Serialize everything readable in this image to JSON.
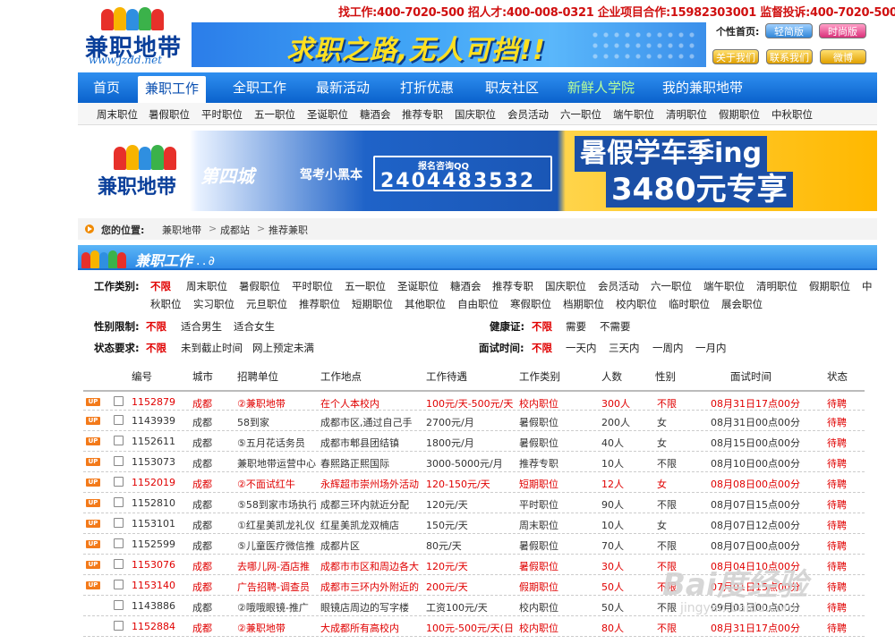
{
  "logo": {
    "text": "兼职地带",
    "url": "www.jzdd.net",
    "figure_colors": [
      "#e7302a",
      "#f8b400",
      "#2f8fe0",
      "#3bb24a",
      "#e7302a"
    ]
  },
  "hotline": "找工作:400-7020-500  招人才:400-008-0321  企业项目合作:15982303001  监督投诉:400-7020-500",
  "banner": {
    "slogan": "求职之路,无人可挡!!"
  },
  "header_buttons": {
    "personal_label": "个性首页:",
    "skin1": "轻简版",
    "skin2": "时尚版",
    "about": "关于我们",
    "contact": "联系我们",
    "weibo": "微博"
  },
  "main_nav": [
    {
      "label": "首页",
      "active": false
    },
    {
      "label": "兼职工作",
      "active": true
    },
    {
      "label": "全职工作",
      "active": false
    },
    {
      "label": "最新活动",
      "active": false
    },
    {
      "label": "打折优惠",
      "active": false
    },
    {
      "label": "职友社区",
      "active": false
    },
    {
      "label": "新鲜人学院",
      "active": false
    },
    {
      "label": "我的兼职地带",
      "active": false
    }
  ],
  "sub_nav": [
    "周末职位",
    "暑假职位",
    "平时职位",
    "五一职位",
    "圣诞职位",
    "糖酒会",
    "推荐专职",
    "国庆职位",
    "会员活动",
    "六一职位",
    "端午职位",
    "清明职位",
    "假期职位",
    "中秋职位"
  ],
  "ad": {
    "logo": "兼职地带",
    "brand": "第四城",
    "brand2": "驾考小黑本",
    "qq_label": "报名咨询QQ",
    "qq": "2404483532",
    "promo1": "暑假学车季ing",
    "promo2": "3480元专享"
  },
  "breadcrumb": {
    "label": "您的位置:",
    "items": [
      "兼职地带",
      "成都站",
      "推荐兼职"
    ],
    "sep": ">"
  },
  "section_title": "兼职工作",
  "filters": {
    "job_type_label": "工作类别:",
    "job_types_row1": [
      "不限",
      "周末职位",
      "暑假职位",
      "平时职位",
      "五一职位",
      "圣诞职位",
      "糖酒会",
      "推荐专职",
      "国庆职位",
      "会员活动",
      "六一职位",
      "端午职位",
      "清明职位",
      "假期职位",
      "中"
    ],
    "job_types_row2": [
      "秋职位",
      "实习职位",
      "元旦职位",
      "推荐职位",
      "短期职位",
      "其他职位",
      "自由职位",
      "寒假职位",
      "档期职位",
      "校内职位",
      "临时职位",
      "展会职位"
    ],
    "gender_label": "性别限制:",
    "genders": [
      "不限",
      "适合男生",
      "适合女生"
    ],
    "health_label": "健康证:",
    "health": [
      "不限",
      "需要",
      "不需要"
    ],
    "status_label": "状态要求:",
    "statuses": [
      "不限",
      "未到截止时间",
      "网上预定未满"
    ],
    "interview_label": "面试时间:",
    "interview": [
      "不限",
      "一天内",
      "三天内",
      "一周内",
      "一月内"
    ]
  },
  "table": {
    "headers": [
      "编号",
      "城市",
      "招聘单位",
      "工作地点",
      "工作待遇",
      "工作类别",
      "人数",
      "性别",
      "面试时间",
      "状态"
    ],
    "rows": [
      {
        "up": "UP",
        "id": "1152879",
        "city": "成都",
        "company": "②兼职地带",
        "location": "在个人本校内",
        "pay": "100元/天-500元/天",
        "type": "校内职位",
        "count": "300人",
        "gender": "不限",
        "time": "08月31日17点00分",
        "status": "待聘",
        "red": true
      },
      {
        "up": "UP",
        "id": "1143939",
        "city": "成都",
        "company": "58到家",
        "location": "成都市区,通过自己手",
        "pay": "2700元/月",
        "type": "暑假职位",
        "count": "200人",
        "gender": "女",
        "time": "08月31日00点00分",
        "status": "待聘",
        "red": false
      },
      {
        "up": "UP",
        "id": "1152611",
        "city": "成都",
        "company": "⑤五月花话务员",
        "location": "成都市郫县团结镇",
        "pay": "1800元/月",
        "type": "暑假职位",
        "count": "40人",
        "gender": "女",
        "time": "08月15日00点00分",
        "status": "待聘",
        "red": false
      },
      {
        "up": "UP",
        "id": "1153073",
        "city": "成都",
        "company": "兼职地带运营中心",
        "location": "春熙路正熙国际",
        "pay": "3000-5000元/月",
        "type": "推荐专职",
        "count": "10人",
        "gender": "不限",
        "time": "08月10日00点00分",
        "status": "待聘",
        "red": false
      },
      {
        "up": "UP",
        "id": "1152019",
        "city": "成都",
        "company": "②不面试红牛",
        "location": "永辉超市崇州场外活动",
        "pay": "120-150元/天",
        "type": "短期职位",
        "count": "12人",
        "gender": "女",
        "time": "08月08日00点00分",
        "status": "待聘",
        "red": true
      },
      {
        "up": "UP",
        "id": "1152810",
        "city": "成都",
        "company": "⑤58到家市场执行",
        "location": "成都三环内就近分配",
        "pay": "120元/天",
        "type": "平时职位",
        "count": "90人",
        "gender": "不限",
        "time": "08月07日15点00分",
        "status": "待聘",
        "red": false
      },
      {
        "up": "UP",
        "id": "1153101",
        "city": "成都",
        "company": "①红星美凯龙礼仪",
        "location": "红星美凯龙双楠店",
        "pay": "150元/天",
        "type": "周末职位",
        "count": "10人",
        "gender": "女",
        "time": "08月07日12点00分",
        "status": "待聘",
        "red": false
      },
      {
        "up": "UP",
        "id": "1152599",
        "city": "成都",
        "company": "⑤儿童医疗微信推",
        "location": "成都片区",
        "pay": "80元/天",
        "type": "暑假职位",
        "count": "70人",
        "gender": "不限",
        "time": "08月07日00点00分",
        "status": "待聘",
        "red": false
      },
      {
        "up": "UP",
        "id": "1153076",
        "city": "成都",
        "company": "去哪儿网-酒店推",
        "location": "成都市市区和周边各大",
        "pay": "120元/天",
        "type": "暑假职位",
        "count": "30人",
        "gender": "不限",
        "time": "08月04日10点00分",
        "status": "待聘",
        "red": true
      },
      {
        "up": "UP",
        "id": "1153140",
        "city": "成都",
        "company": "广告招聘-调查员",
        "location": "成都市三环内外附近的",
        "pay": "200元/天",
        "type": "假期职位",
        "count": "50人",
        "gender": "不限",
        "time": "07月01日15点00分",
        "status": "待聘",
        "red": true
      },
      {
        "up": "",
        "id": "1143886",
        "city": "成都",
        "company": "②哦哦眼镜-推广",
        "location": "眼镜店周边的写字楼",
        "pay": "工资100元/天",
        "type": "校内职位",
        "count": "50人",
        "gender": "不限",
        "time": "09月01日00点00分",
        "status": "待聘",
        "red": false
      },
      {
        "up": "",
        "id": "1152884",
        "city": "成都",
        "company": "②兼职地带",
        "location": "大成都所有高校内",
        "pay": "100元-500元/天(日",
        "type": "校内职位",
        "count": "80人",
        "gender": "不限",
        "time": "08月31日17点00分",
        "status": "待聘",
        "red": true
      }
    ]
  },
  "watermark": {
    "main": "Bai度经验",
    "sub": "jingyan.baidu.com"
  }
}
